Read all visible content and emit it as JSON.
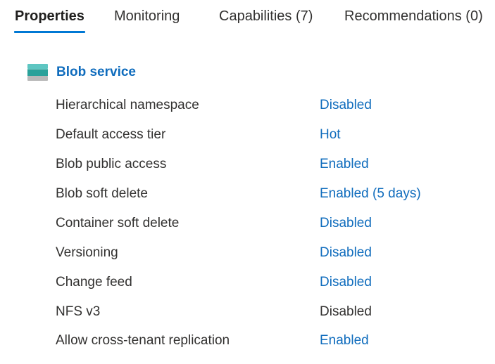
{
  "tabs": [
    {
      "label": "Properties",
      "active": true
    },
    {
      "label": "Monitoring",
      "active": false
    },
    {
      "label": "Capabilities (7)",
      "active": false
    },
    {
      "label": "Recommendations (0)",
      "active": false
    }
  ],
  "section": {
    "title": "Blob service",
    "icon": "storage-container-icon",
    "icon_colors": {
      "top": "#5ec6c2",
      "middle": "#2aa19a",
      "bottom": "#b9b9b9"
    }
  },
  "properties": [
    {
      "label": "Hierarchical namespace",
      "value": "Disabled",
      "is_link": true
    },
    {
      "label": "Default access tier",
      "value": "Hot",
      "is_link": true
    },
    {
      "label": "Blob public access",
      "value": "Enabled",
      "is_link": true
    },
    {
      "label": "Blob soft delete",
      "value": "Enabled (5 days)",
      "is_link": true
    },
    {
      "label": "Container soft delete",
      "value": "Disabled",
      "is_link": true
    },
    {
      "label": "Versioning",
      "value": "Disabled",
      "is_link": true
    },
    {
      "label": "Change feed",
      "value": "Disabled",
      "is_link": true
    },
    {
      "label": "NFS v3",
      "value": "Disabled",
      "is_link": false
    },
    {
      "label": "Allow cross-tenant replication",
      "value": "Enabled",
      "is_link": true
    }
  ],
  "colors": {
    "accent": "#0078d4",
    "link": "#0f6cbd",
    "text": "#323130"
  }
}
